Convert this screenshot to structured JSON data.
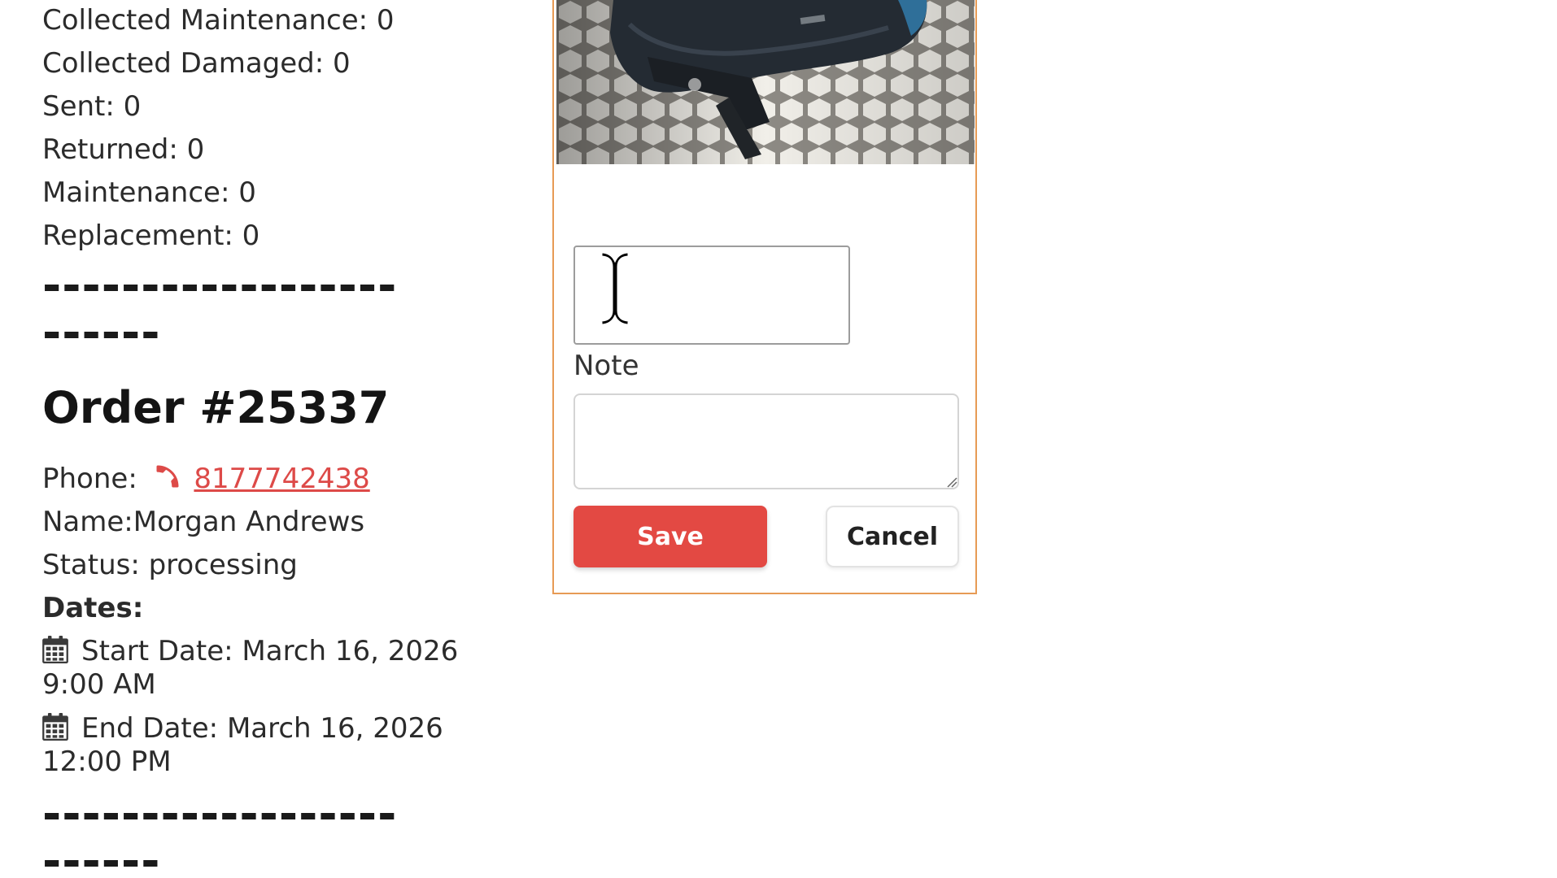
{
  "stats": [
    "Collected Maintenance: 0",
    "Collected Damaged: 0",
    "Sent: 0",
    "Returned: 0",
    "Maintenance: 0",
    "Replacement: 0"
  ],
  "separator": {
    "line1": "------------------",
    "line2": "------"
  },
  "order": {
    "title": "Order #25337",
    "phone_label": "Phone:",
    "phone_number": "8177742438",
    "name_line": "Name:Morgan Andrews",
    "status_line": "Status: processing",
    "dates_heading": "Dates:",
    "start_line1": "Start Date: March 16, 2026",
    "start_line2": "9:00 AM",
    "end_line1": "End Date: March 16, 2026",
    "end_line2": "12:00 PM"
  },
  "form": {
    "image_subject": "helmet photo",
    "quantity_value": "",
    "note_label": "Note",
    "note_value": "",
    "save_label": "Save",
    "cancel_label": "Cancel"
  },
  "icons": {
    "phone": "phone-icon",
    "calendar": "calendar-icon",
    "cursor": "text-cursor-icon"
  },
  "colors": {
    "accent_red": "#e34943",
    "link_red": "#dd4a48",
    "card_border": "#e79b55"
  }
}
